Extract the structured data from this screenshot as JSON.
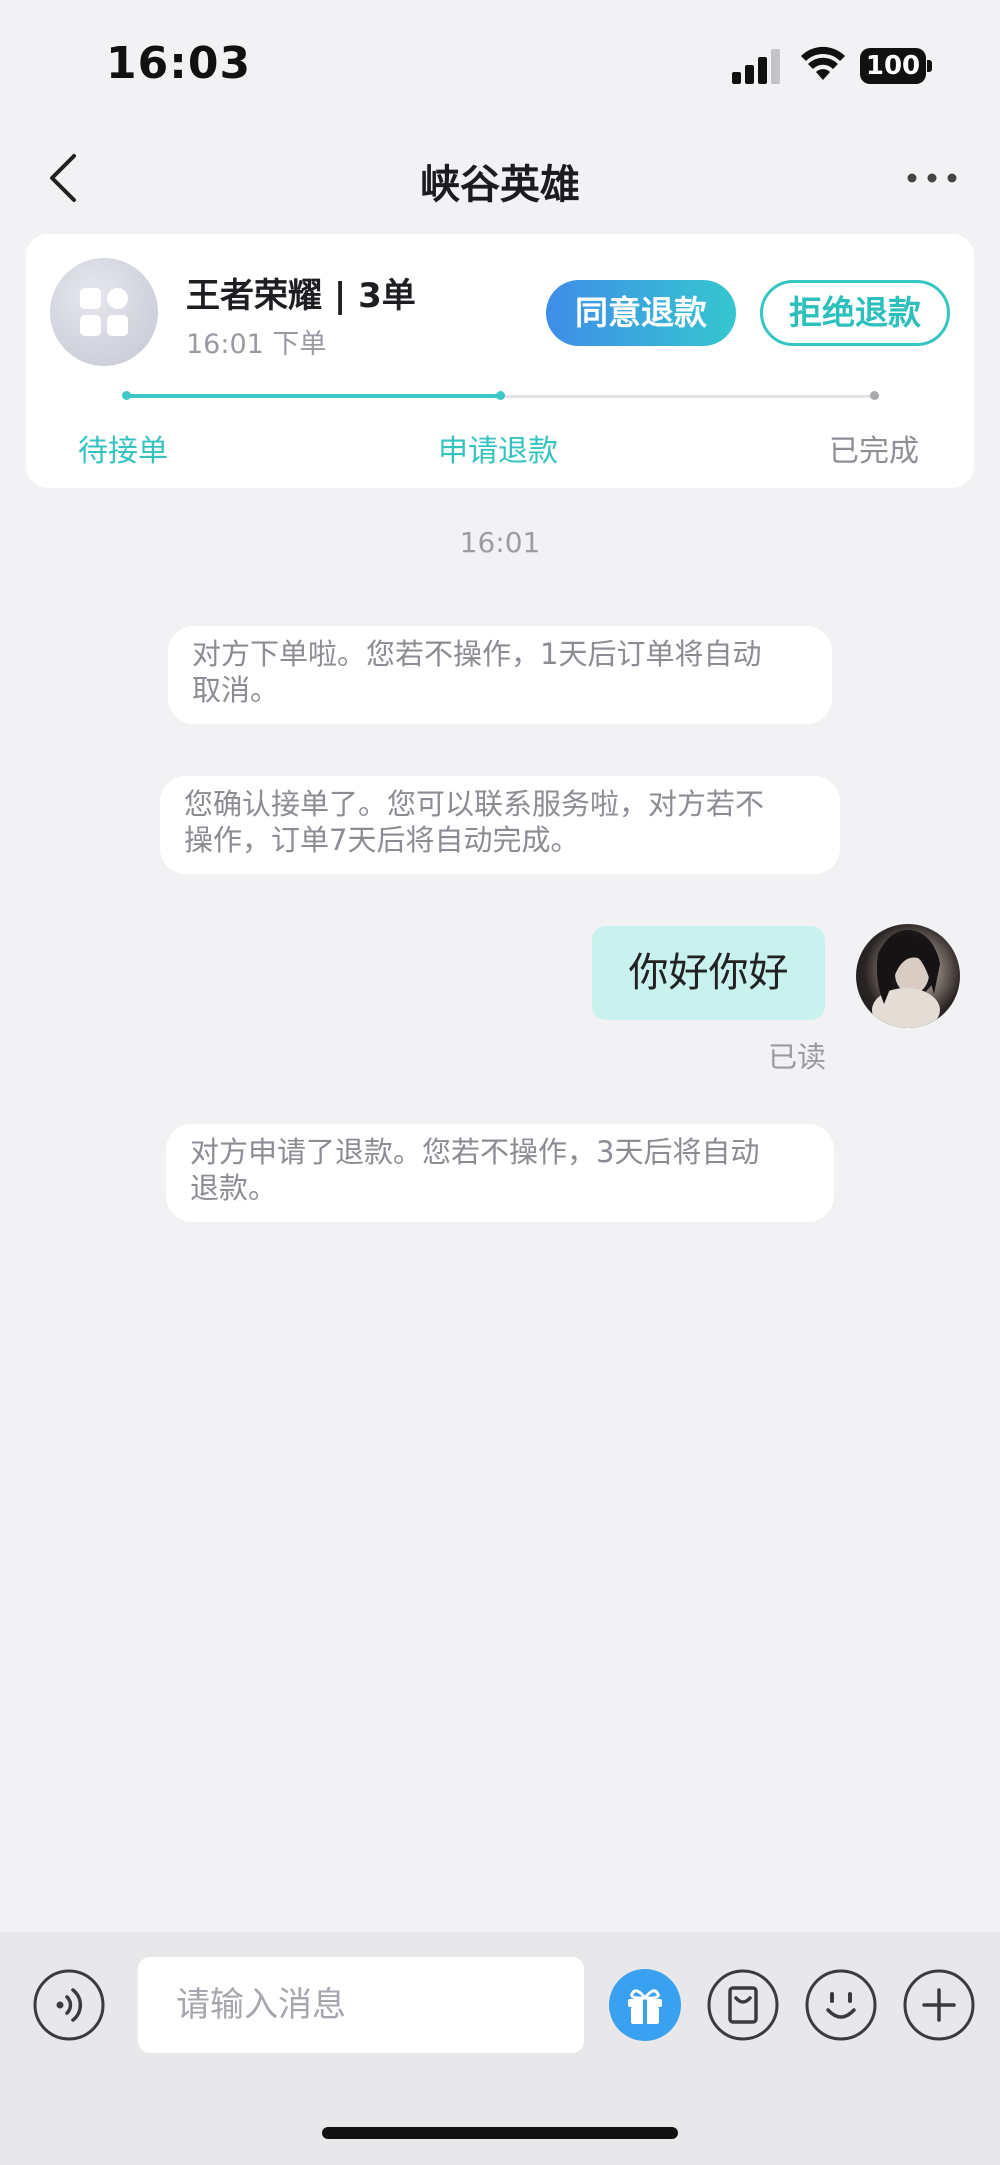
{
  "status_bar": {
    "time": "16:03",
    "battery": "100",
    "icons": [
      "signal-icon",
      "wifi-icon",
      "battery-icon"
    ]
  },
  "nav": {
    "title": "峡谷英雄",
    "back_icon": "chevron-left-icon",
    "more_icon": "more-horizontal-icon"
  },
  "order": {
    "avatar_icon": "apps-grid-icon",
    "title": "王者荣耀 | 3单",
    "subtitle": "16:01 下单",
    "agree_label": "同意退款",
    "reject_label": "拒绝退款",
    "steps": [
      "待接单",
      "申请退款",
      "已完成"
    ],
    "current_step": 2,
    "progress_fraction": 0.5,
    "colors": {
      "accent": "#34c3c0",
      "agree_gradient_start": "#3f8de8",
      "agree_gradient_end": "#35c7cf"
    }
  },
  "chat": {
    "timestamp": "16:01",
    "system_messages": [
      {
        "lines": [
          "对方下单啦。您若不操作，1天后订单将自动",
          "取消。"
        ]
      },
      {
        "lines": [
          "您确认接单了。您可以联系服务啦，对方若不",
          "操作，订单7天后将自动完成。"
        ]
      },
      {
        "lines": [
          "对方申请了退款。您若不操作，3天后将自动",
          "退款。"
        ]
      }
    ],
    "my_message": "你好你好",
    "read_status": "已读",
    "bubble_color": "#c9f2ee"
  },
  "input_bar": {
    "placeholder": "请输入消息",
    "icons": [
      "voice-icon",
      "gift-icon",
      "order-bag-icon",
      "emoji-icon",
      "plus-icon"
    ],
    "gift_color": "#3aa0f0"
  }
}
